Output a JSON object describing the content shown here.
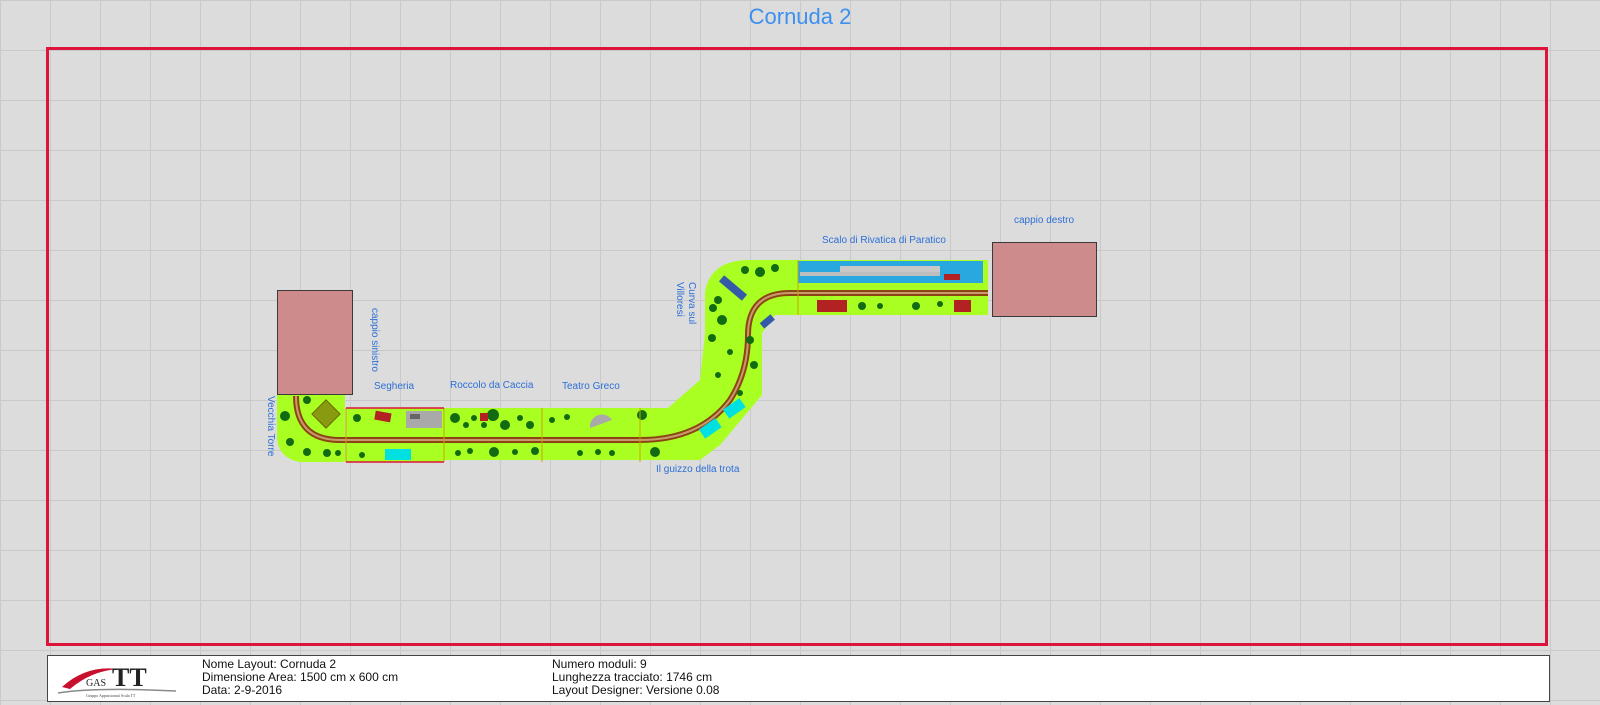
{
  "title": "Cornuda 2",
  "modules": {
    "vecchia_torre": "Vecchia Torre",
    "cappio_sinistro": "cappio sinistro",
    "segheria": "Segheria",
    "roccolo": "Roccolo da Caccia",
    "teatro_greco": "Teatro Greco",
    "guizzo_trota": "Il guizzo della trota",
    "curva_villoresi": "Curva sul Villoresi",
    "scalo_rivatica": "Scalo di Rivatica di Paratico",
    "cappio_destro": "cappio destro"
  },
  "info": {
    "nome_layout": "Nome Layout: Cornuda 2",
    "dimensione_area": "Dimensione Area: 1500 cm x 600 cm",
    "data": "Data: 2-9-2016",
    "numero_moduli": "Numero moduli: 9",
    "lunghezza_tracciato": "Lunghezza tracciato: 1746 cm",
    "layout_designer": "Layout Designer: Versione 0.08"
  },
  "logo": {
    "text_gas": "GAS",
    "text_tt": "TT",
    "subtitle": "Gruppo Appassionati Scala TT"
  },
  "colors": {
    "title": "#3d8ff0",
    "frame": "#dc143c",
    "module_green": "#aaff22",
    "tree": "#1a6b1a",
    "loop_block": "#cd8b8b",
    "track": "#8b4513",
    "label": "#2d6fd6"
  }
}
